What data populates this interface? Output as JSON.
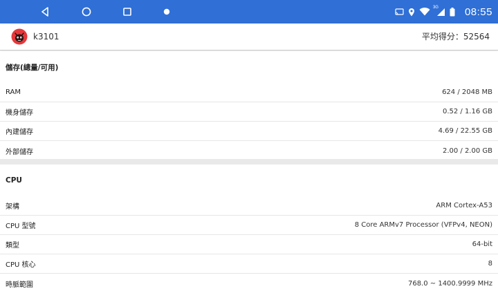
{
  "statusbar": {
    "clock": "08:55",
    "network_badge": "3G",
    "icons": [
      "cast-icon",
      "location-icon",
      "wifi-icon",
      "signal-icon",
      "battery-icon"
    ],
    "nav_icons": [
      "back-icon",
      "home-icon",
      "recent-apps-icon",
      "dot-icon"
    ],
    "background": "#2f6fd6"
  },
  "header": {
    "device_name": "k3101",
    "score_text": "平均得分：52564"
  },
  "storage": {
    "title": "儲存(總量/可用)",
    "rows": [
      {
        "label": "RAM",
        "value": "624 / 2048 MB"
      },
      {
        "label": "機身儲存",
        "value": "0.52 / 1.16 GB"
      },
      {
        "label": "內建儲存",
        "value": "4.69 / 22.55 GB"
      },
      {
        "label": "外部儲存",
        "value": "2.00 / 2.00 GB"
      }
    ]
  },
  "cpu": {
    "title": "CPU",
    "rows": [
      {
        "label": "架構",
        "value": "ARM Cortex-A53"
      },
      {
        "label": "CPU 型號",
        "value": "8 Core ARMv7 Processor (VFPv4, NEON)"
      },
      {
        "label": "類型",
        "value": "64-bit"
      },
      {
        "label": "CPU 核心",
        "value": "8"
      },
      {
        "label": "時脈範圍",
        "value": "768.0 ~ 1400.9999 MHz"
      }
    ]
  }
}
